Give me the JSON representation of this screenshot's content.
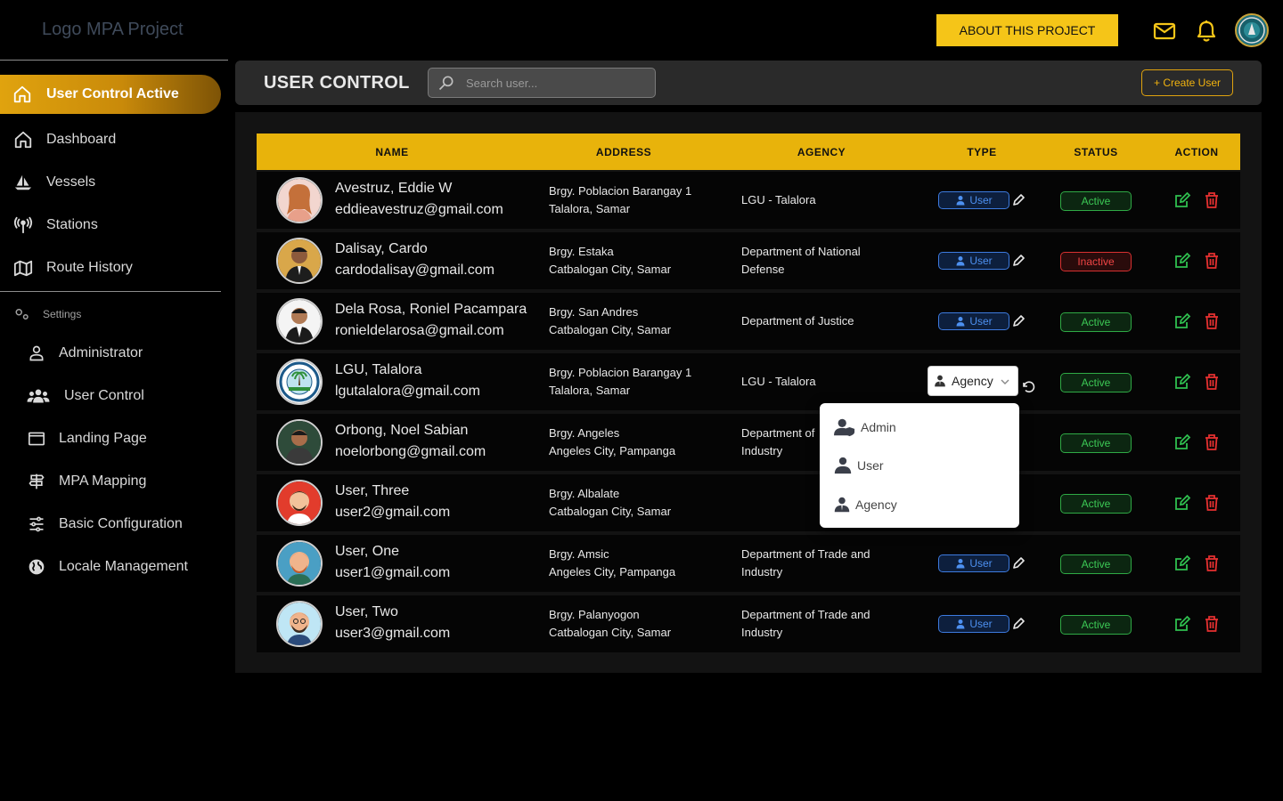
{
  "app": {
    "logo_text": "Logo MPA Project"
  },
  "sidebar": {
    "active_item": {
      "label": "User Control Active",
      "icon": "home-icon"
    },
    "items": [
      {
        "label": "Dashboard",
        "icon": "home-icon"
      },
      {
        "label": "Vessels",
        "icon": "sailboat-icon"
      },
      {
        "label": "Stations",
        "icon": "antenna-icon"
      },
      {
        "label": "Route History",
        "icon": "map-icon"
      }
    ],
    "settings_label": "Settings",
    "settings_items": [
      {
        "label": "Administrator",
        "icon": "person-icon"
      },
      {
        "label": "User Control",
        "icon": "users-icon"
      },
      {
        "label": "Landing Page",
        "icon": "window-icon"
      },
      {
        "label": "MPA Mapping",
        "icon": "signpost-icon"
      },
      {
        "label": "Basic Configuration",
        "icon": "sliders-icon"
      },
      {
        "label": "Locale Management",
        "icon": "globe-icon"
      }
    ]
  },
  "topbar": {
    "about_button": "ABOUT THIS PROJECT",
    "icons": [
      "mail-icon",
      "bell-icon",
      "profile-avatar"
    ]
  },
  "header": {
    "title": "USER CONTROL",
    "search_placeholder": "Search user...",
    "create_button": "+ Create User"
  },
  "table": {
    "columns": [
      "NAME",
      "ADDRESS",
      "AGENCY",
      "TYPE",
      "STATUS",
      "ACTION"
    ],
    "rows": [
      {
        "name": "Avestruz, Eddie W",
        "email": "eddieavestruz@gmail.com",
        "address1": "Brgy. Poblacion Barangay 1",
        "address2": "Talalora, Samar",
        "agency1": "LGU - Talalora",
        "agency2": "",
        "type": "User",
        "status": "Active"
      },
      {
        "name": "Dalisay, Cardo",
        "email": "cardodalisay@gmail.com",
        "address1": "Brgy. Estaka",
        "address2": "Catbalogan City, Samar",
        "agency1": "Department of National",
        "agency2": "Defense",
        "type": "User",
        "status": "Inactive"
      },
      {
        "name": "Dela Rosa, Roniel Pacampara",
        "email": "ronieldelarosa@gmail.com",
        "address1": "Brgy. San Andres",
        "address2": "Catbalogan City, Samar",
        "agency1": "Department of Justice",
        "agency2": "",
        "type": "User",
        "status": "Active"
      },
      {
        "name": "LGU, Talalora",
        "email": "lgutalalora@gmail.com",
        "address1": "Brgy. Poblacion Barangay 1",
        "address2": "Talalora, Samar",
        "agency1": "LGU - Talalora",
        "agency2": "",
        "type": "Agency",
        "status": "Active"
      },
      {
        "name": "Orbong, Noel Sabian",
        "email": "noelorbong@gmail.com",
        "address1": "Brgy. Angeles",
        "address2": "Angeles City, Pampanga",
        "agency1": "Department of",
        "agency2": "Industry",
        "type": "",
        "status": "Active"
      },
      {
        "name": "User, Three",
        "email": "user2@gmail.com",
        "address1": "Brgy. Albalate",
        "address2": "Catbalogan City, Samar",
        "agency1": "",
        "agency2": "",
        "type": "",
        "status": "Active"
      },
      {
        "name": "User, One",
        "email": "user1@gmail.com",
        "address1": "Brgy. Amsic",
        "address2": "Angeles City, Pampanga",
        "agency1": "Department of Trade and",
        "agency2": "Industry",
        "type": "User",
        "status": "Active"
      },
      {
        "name": "User, Two",
        "email": "user3@gmail.com",
        "address1": "Brgy. Palanyogon",
        "address2": "Catbalogan City, Samar",
        "agency1": "Department of Trade and",
        "agency2": "Industry",
        "type": "User",
        "status": "Active"
      }
    ]
  },
  "type_dropdown": {
    "selected": "Agency",
    "options": [
      "Admin",
      "User",
      "Agency"
    ]
  },
  "colors": {
    "accent": "#e8b30b",
    "active_status": "#3cc955",
    "inactive_status": "#f04545",
    "user_badge": "#4d90f0"
  }
}
